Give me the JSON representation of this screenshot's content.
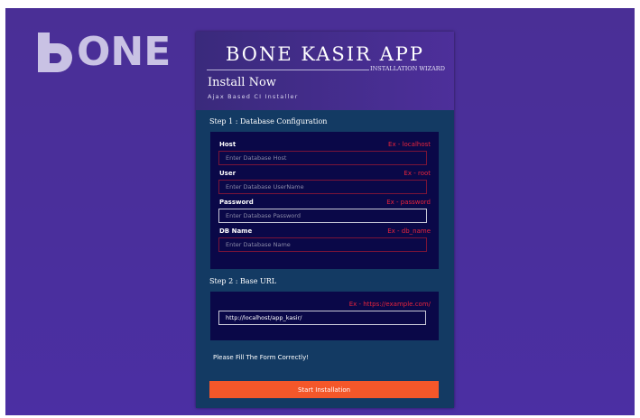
{
  "brand": {
    "logo_text": "ONE",
    "logo_full": "BONE"
  },
  "header": {
    "app_title": "BONE KASIR APP",
    "wizard_label": "INSTALLATION WIZARD",
    "heading": "Install Now",
    "subheading": "Ajax Based CI Installer"
  },
  "step1": {
    "title": "Step 1 : Database Configuration",
    "fields": [
      {
        "label": "Host",
        "hint": "Ex - localhost",
        "placeholder": "Enter Database Host",
        "value": ""
      },
      {
        "label": "User",
        "hint": "Ex - root",
        "placeholder": "Enter Database UserName",
        "value": ""
      },
      {
        "label": "Password",
        "hint": "Ex - password",
        "placeholder": "Enter Database Password",
        "value": ""
      },
      {
        "label": "DB Name",
        "hint": "Ex - db_name",
        "placeholder": "Enter Database Name",
        "value": ""
      }
    ]
  },
  "step2": {
    "title": "Step 2 : Base URL",
    "hint": "Ex - https://example.com/",
    "value": "http://localhost/app_kasir/"
  },
  "status_message": "Please Fill The Form Correctly!",
  "start_button_label": "Start Installation",
  "colors": {
    "background": "#4a2f96",
    "header": "#4d2f9a",
    "body": "#133a63",
    "panel": "#0a0848",
    "hint": "#e8243c",
    "button": "#f4572a"
  }
}
